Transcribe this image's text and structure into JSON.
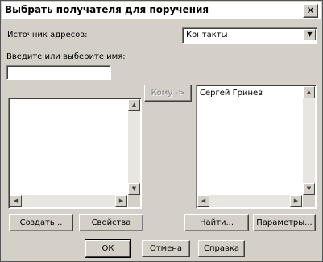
{
  "window": {
    "title": "Выбрать получателя для поручения"
  },
  "source": {
    "label": "Источник адресов:",
    "value": "Контакты"
  },
  "name": {
    "label": "Введите или выберите имя:",
    "value": ""
  },
  "add_button": "Кому ->",
  "recipients": [
    "Сергей Гринев"
  ],
  "buttons": {
    "create": "Создать...",
    "properties": "Свойства",
    "find": "Найти...",
    "parameters": "Параметры...",
    "ok": "ОК",
    "cancel": "Отмена",
    "help": "Справка"
  }
}
